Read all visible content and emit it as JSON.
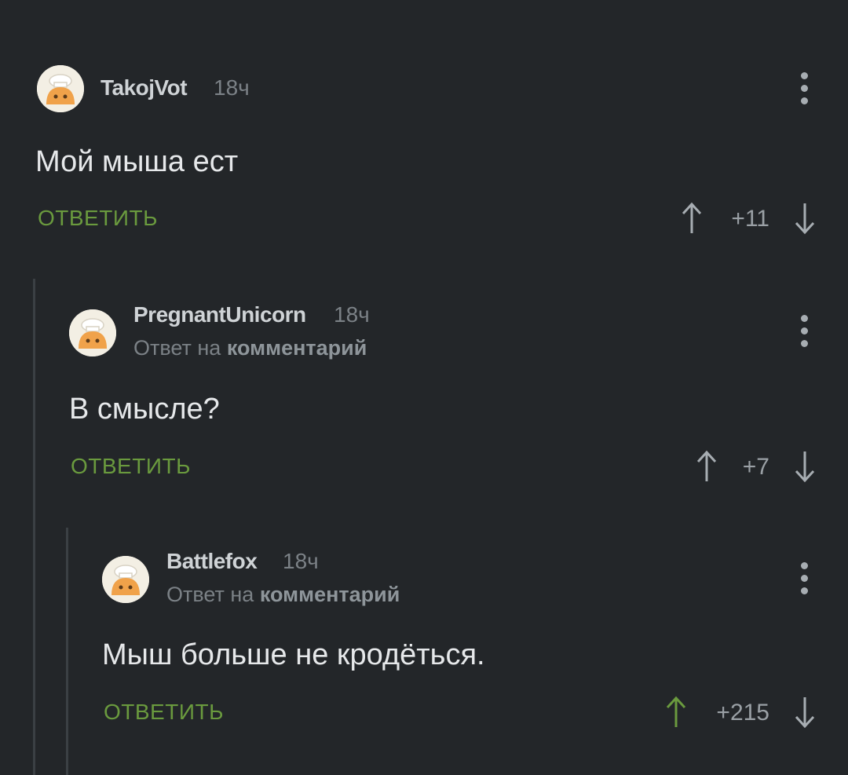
{
  "colors": {
    "background": "#232629",
    "accent_green": "#6a9a3e",
    "thread_line": "#3b4044"
  },
  "comments": [
    {
      "author": "TakojVot",
      "time": "18ч",
      "reply_to": null,
      "text": "Мой мыша ест",
      "reply_label": "ОТВЕТИТЬ",
      "score": "+11",
      "upvoted": false,
      "avatar_icon": "chef-avatar-icon",
      "menu_icon": "more-vertical-icon"
    },
    {
      "author": "PregnantUnicorn",
      "time": "18ч",
      "reply_to": {
        "prefix": "Ответ на",
        "target": "комментарий"
      },
      "text": "В смысле?",
      "reply_label": "ОТВЕТИТЬ",
      "score": "+7",
      "upvoted": false,
      "avatar_icon": "chef-avatar-icon",
      "menu_icon": "more-vertical-icon"
    },
    {
      "author": "Battlefox",
      "time": "18ч",
      "reply_to": {
        "prefix": "Ответ на",
        "target": "комментарий"
      },
      "text": "Мыш больше не кродёться.",
      "reply_label": "ОТВЕТИТЬ",
      "score": "+215",
      "upvoted": true,
      "avatar_icon": "chef-avatar-icon",
      "menu_icon": "more-vertical-icon"
    }
  ]
}
